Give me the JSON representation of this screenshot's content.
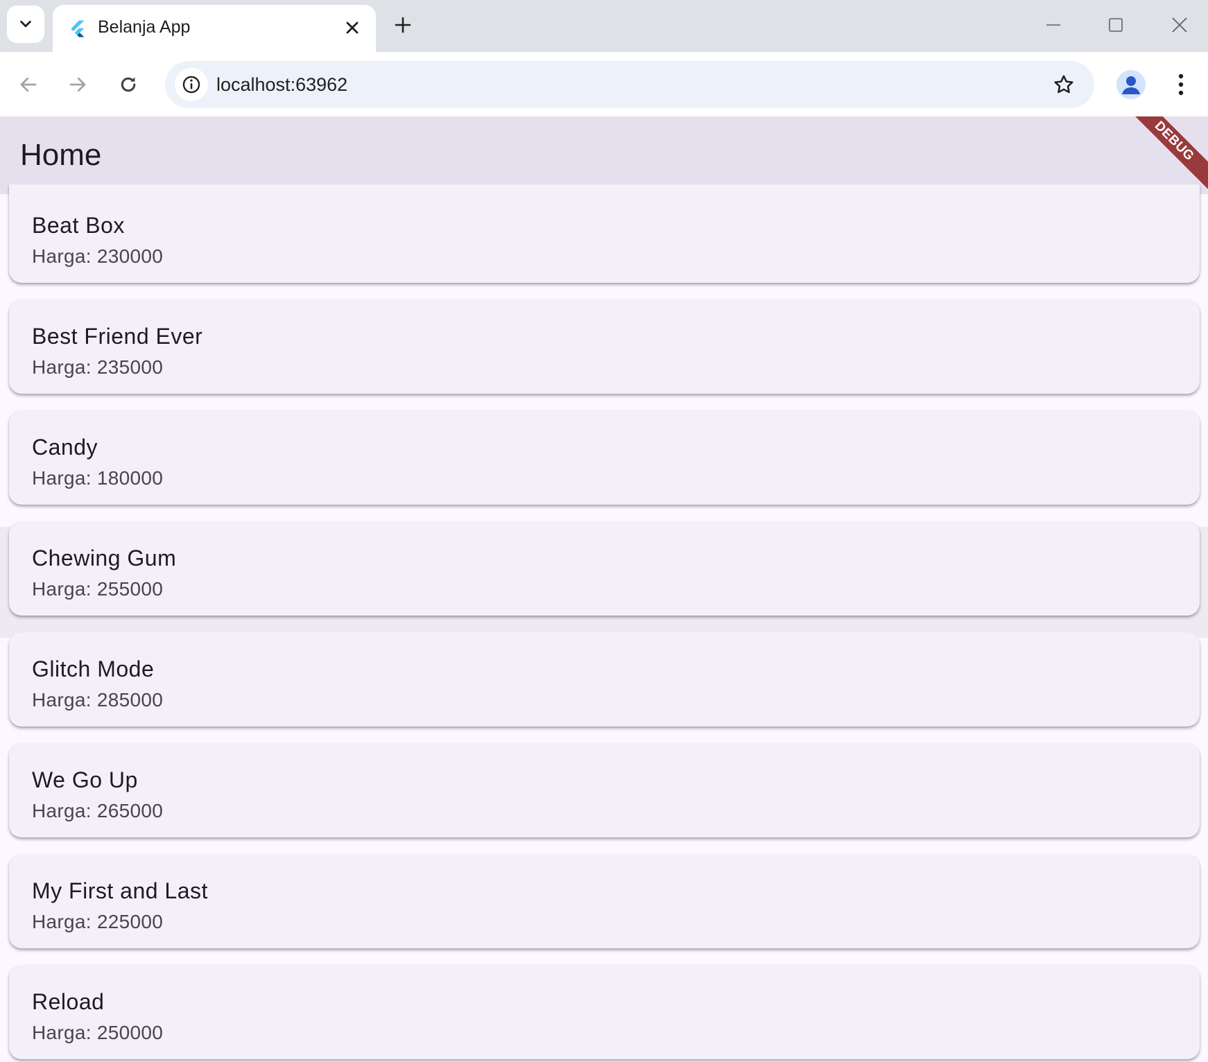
{
  "browser": {
    "tab_title": "Belanja App",
    "url": "localhost:63962"
  },
  "app": {
    "title": "Home",
    "debug_label": "DEBUG",
    "price_prefix": "Harga:",
    "items": [
      {
        "name": "Beat Box",
        "price_text": "Harga: 230000"
      },
      {
        "name": "Best Friend Ever",
        "price_text": "Harga: 235000"
      },
      {
        "name": "Candy",
        "price_text": "Harga: 180000"
      },
      {
        "name": "Chewing Gum",
        "price_text": "Harga: 255000"
      },
      {
        "name": "Glitch Mode",
        "price_text": "Harga: 285000"
      },
      {
        "name": "We Go Up",
        "price_text": "Harga: 265000"
      },
      {
        "name": "My First and Last",
        "price_text": "Harga: 225000"
      },
      {
        "name": "Reload",
        "price_text": "Harga: 250000"
      }
    ]
  },
  "colors": {
    "appbar": "#e6e0ee",
    "card": "#f4f0f8",
    "background": "#fdf7ff",
    "debug_banner": "#9a3a3c"
  }
}
